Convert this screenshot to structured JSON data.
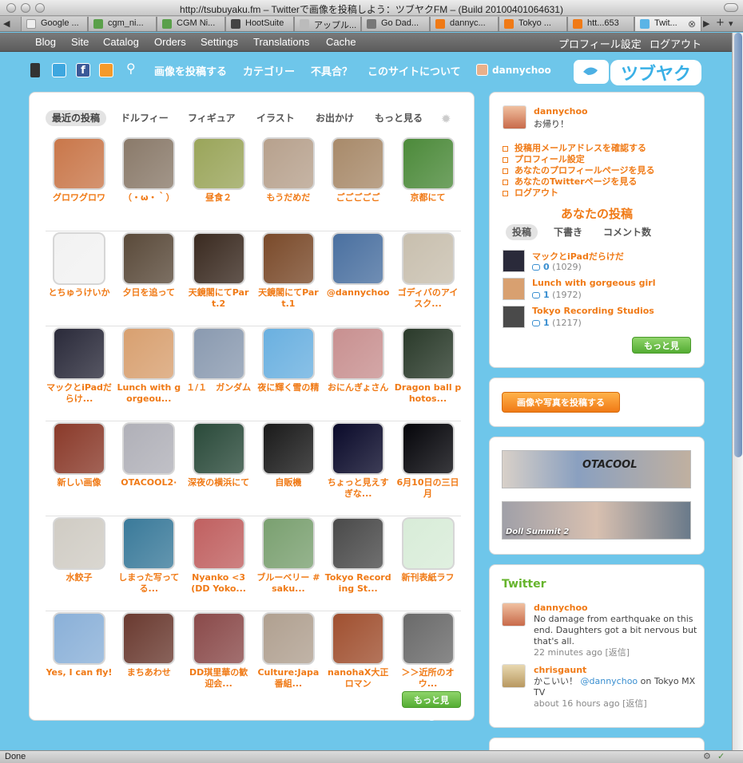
{
  "window": {
    "title": "http://tsubuyaku.fm – Twitterで画像を投稿しよう：ツブヤクFM – (Build 20100401064631)",
    "tabs": [
      {
        "label": "Google ..."
      },
      {
        "label": "cgm_ni..."
      },
      {
        "label": "CGM Ni..."
      },
      {
        "label": "HootSuite"
      },
      {
        "label": "アップル..."
      },
      {
        "label": "Go Dad..."
      },
      {
        "label": "dannyc..."
      },
      {
        "label": "Tokyo ..."
      },
      {
        "label": "htt...653"
      },
      {
        "label": "Twit..."
      }
    ],
    "tab_new": "+",
    "status": "Done"
  },
  "adminbar": {
    "left": [
      "Blog",
      "Site",
      "Catalog",
      "Orders",
      "Settings",
      "Translations",
      "Cache"
    ],
    "right": [
      "プロフィール設定",
      "ログアウト"
    ]
  },
  "header": {
    "nav": [
      "画像を投稿する",
      "カテゴリー",
      "不具合？",
      "このサイトについて"
    ],
    "user": "dannychoo",
    "logo_text": "ツブヤク"
  },
  "filters": {
    "tabs": [
      "最近の投稿",
      "ドルフィー",
      "フィギュア",
      "イラスト",
      "お出かけ",
      "もっと見る"
    ]
  },
  "grid": [
    [
      "グロワグロワ",
      "（・ω・｀）",
      "昼食２",
      "もうだめだ",
      "ごごごごご",
      "京都にて"
    ],
    [
      "とちゅうけいか",
      "夕日を追って",
      "天鏡閣にてPart.2",
      "天鏡閣にてPart.1",
      "@dannychoo",
      "ゴディバのアイスク..."
    ],
    [
      "マックとiPadだらけ...",
      "Lunch with gorgeou...",
      "１/１　ガンダム",
      "夜に輝く雪の精",
      "おにんぎょさん",
      "Dragon ball photos..."
    ],
    [
      "新しい画像",
      "OTACOOL2·",
      "深夜の横浜にて",
      "自販機",
      "ちょっと見えすぎな...",
      "6月10日の三日月"
    ],
    [
      "水餃子",
      "しまった写ってる...",
      "Nyanko <3 (DD Yoko...",
      "ブルーベリー #saku...",
      "Tokyo Recording St...",
      "新刊表紙ラフ"
    ],
    [
      "Yes, I can fly!",
      "まちあわせ",
      "DD琪里華の歓迎会...",
      "Culture:Japa番組...",
      "nanohaX大正ロマン",
      "＞＞近所のオウ..."
    ]
  ],
  "grid_colors": [
    [
      "#c9774a",
      "#8a7a6a",
      "#9aa55a",
      "#b7a18d",
      "#a88a6a",
      "#4c8a3a"
    ],
    [
      "#f2f2f2",
      "#5a4a3a",
      "#3a2a20",
      "#7a4a2a",
      "#4a70a0",
      "#c8bfae"
    ],
    [
      "#2a2a3a",
      "#d8a070",
      "#8a9ab0",
      "#6ab0e0",
      "#c89090",
      "#2a3a2a"
    ],
    [
      "#8a3a2a",
      "#b0b0b8",
      "#2a4a3a",
      "#1a1a1a",
      "#0a0a2a",
      "#05050a"
    ],
    [
      "#d0ccc4",
      "#3a7a9a",
      "#c06060",
      "#7aa070",
      "#4a4a4a",
      "#d8ecd8"
    ],
    [
      "#8ab0d8",
      "#6a3a30",
      "#8a4a4a",
      "#b0a090",
      "#a05030",
      "#6a6a6a"
    ]
  ],
  "more_label": "もっと見る",
  "profile": {
    "name": "dannychoo",
    "greeting": "お帰り！",
    "menu": [
      "投稿用メールアドレスを確認する",
      "プロフィール設定",
      "あなたのプロフィールページを見る",
      "あなたのTwitterページを見る",
      "ログアウト"
    ],
    "posts_title": "あなたの投稿",
    "post_tabs": [
      "投稿",
      "下書き",
      "コメント数"
    ],
    "posts": [
      {
        "title": "マックとiPadだらけだ",
        "comments": "0",
        "views": "(1029)"
      },
      {
        "title": "Lunch with gorgeous girl",
        "comments": "1",
        "views": "(1972)"
      },
      {
        "title": "Tokyo Recording Studios",
        "comments": "1",
        "views": "(1217)"
      }
    ],
    "more_label": "もっと見る"
  },
  "upload_button": "画像や写真を投稿する",
  "banners": [
    "OTACOOL",
    "Doll Summit 2"
  ],
  "twitter": {
    "title": "Twitter",
    "tweets": [
      {
        "user": "dannychoo",
        "text": "No damage from earthquake on this end. Daughters got a bit nervous but that's all.",
        "time": "22 minutes ago [返信]"
      },
      {
        "user": "chrisgaunt",
        "pre": "かこいい！",
        "mention": "@dannychoo",
        "post": "on Tokyo MX TV",
        "time": "about 16 hours ago [返信]"
      }
    ]
  },
  "colors": {
    "accent_orange": "#f07a16",
    "sky_blue": "#6ec6ea",
    "green_button": "#66b42c"
  }
}
